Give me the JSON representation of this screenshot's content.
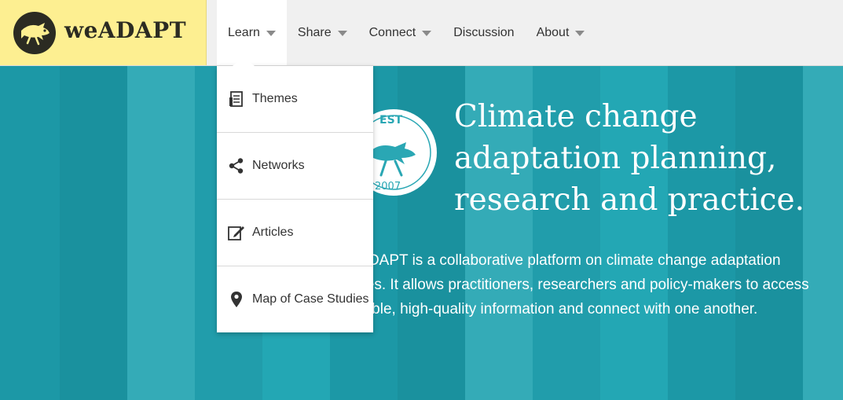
{
  "brand": {
    "name": "weADAPT",
    "color": "#fdef91"
  },
  "nav": {
    "items": [
      {
        "label": "Learn",
        "has_caret": true,
        "active": true
      },
      {
        "label": "Share",
        "has_caret": true
      },
      {
        "label": "Connect",
        "has_caret": true
      },
      {
        "label": "Discussion",
        "has_caret": false
      },
      {
        "label": "About",
        "has_caret": true
      }
    ]
  },
  "dropdown": {
    "items": [
      {
        "label": "Themes",
        "icon": "document-icon"
      },
      {
        "label": "Networks",
        "icon": "share-icon"
      },
      {
        "label": "Articles",
        "icon": "edit-icon"
      },
      {
        "label": "Map of Case Studies",
        "icon": "map-pin-icon"
      }
    ]
  },
  "hero": {
    "badge_top": "EST",
    "badge_year": "2007",
    "title": "Climate change adaptation planning, research and practice.",
    "description": "weADAPT is a collaborative platform on climate change adaptation issues. It allows practitioners, researchers and policy-makers to access credible, high-quality information and connect with one another."
  },
  "colors": {
    "hero_teal": "#2aa7b4",
    "header_bg": "#f0f0f0"
  }
}
